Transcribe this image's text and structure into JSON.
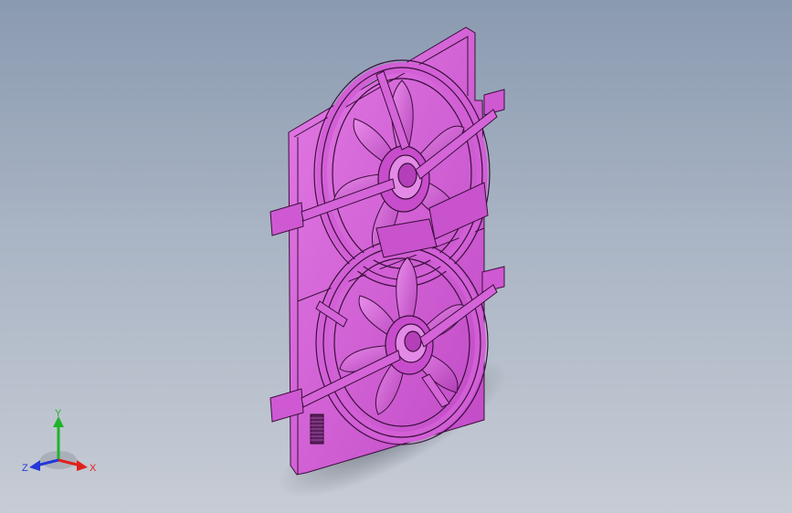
{
  "viewport": {
    "background_top": "#8a9ab0",
    "background_bottom": "#c7ccd5"
  },
  "model": {
    "color": "#d45ad8",
    "edge_color": "#3a0f3c"
  },
  "triad": {
    "x_label": "X",
    "y_label": "Y",
    "z_label": "Z",
    "x_color": "#e0201c",
    "y_color": "#1eb42a",
    "z_color": "#2438d8"
  }
}
